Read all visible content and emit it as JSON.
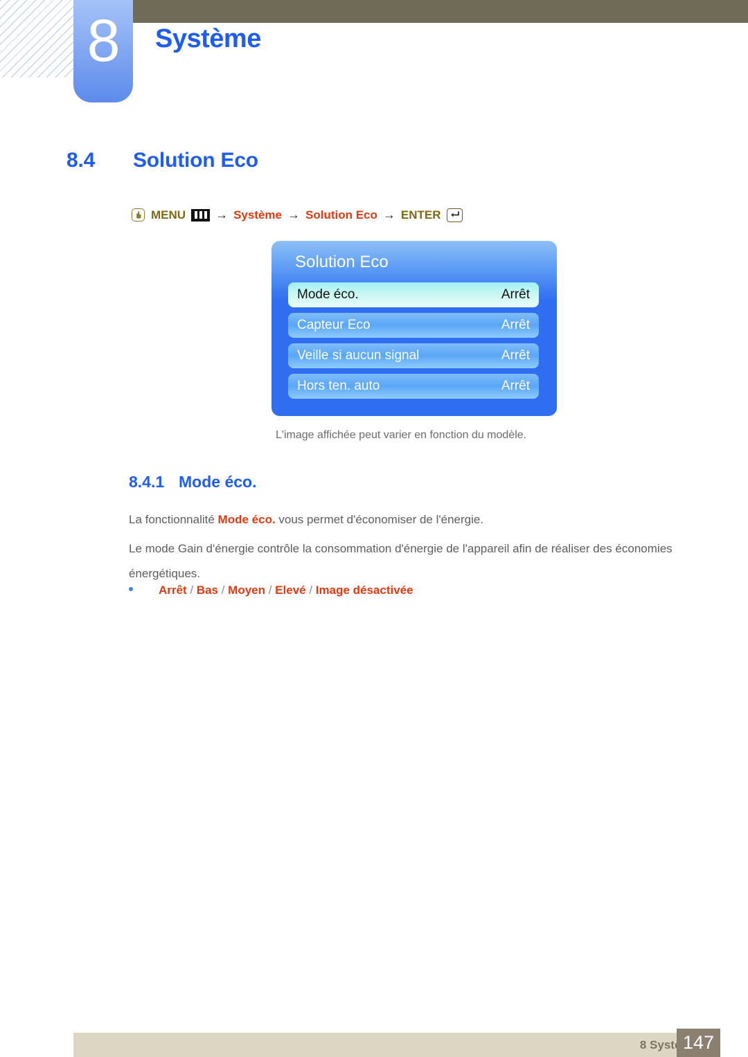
{
  "header": {
    "chapter_number": "8",
    "chapter_title": "Système"
  },
  "section": {
    "number": "8.4",
    "title": "Solution Eco"
  },
  "menu_path": {
    "hand_icon": "hand-press-icon",
    "menu_label": "MENU",
    "menu_icon": "menu-bars-icon",
    "arrow1": "→",
    "step1": "Système",
    "arrow2": "→",
    "step2": "Solution Eco",
    "arrow3": "→",
    "enter_label": "ENTER",
    "enter_icon": "enter-return-icon"
  },
  "osd": {
    "title": "Solution Eco",
    "rows": [
      {
        "label": "Mode éco.",
        "value": "Arrêt",
        "selected": true
      },
      {
        "label": "Capteur Eco",
        "value": "Arrêt",
        "selected": false
      },
      {
        "label": "Veille si aucun signal",
        "value": "Arrêt",
        "selected": false
      },
      {
        "label": "Hors ten. auto",
        "value": "Arrêt",
        "selected": false
      }
    ],
    "caption": "L'image affichée peut varier en fonction du modèle."
  },
  "subsection": {
    "number": "8.4.1",
    "title": "Mode éco.",
    "paragraph_1_before": "La fonctionnalité ",
    "paragraph_1_emph": "Mode éco.",
    "paragraph_1_after": " vous permet d'économiser de l'énergie.",
    "paragraph_2": "Le mode Gain d'énergie contrôle la consommation d'énergie de l'appareil afin de réaliser des économies énergétiques.",
    "options": [
      "Arrêt",
      "Bas",
      "Moyen",
      "Elevé",
      "Image désactivée"
    ],
    "options_separator": " / "
  },
  "footer": {
    "label": "8 Système",
    "page": "147"
  },
  "colors": {
    "accent_blue": "#1d5cf5",
    "accent_orange": "#e03a10",
    "header_olive": "#6e6a55",
    "footer_beige": "#dcd6c3",
    "footer_page_box": "#8b7f6f",
    "osd_blue": "#2f6ef0",
    "osd_selected_cyan": "#9ff0f5",
    "body_gray": "#5d5d5d"
  }
}
